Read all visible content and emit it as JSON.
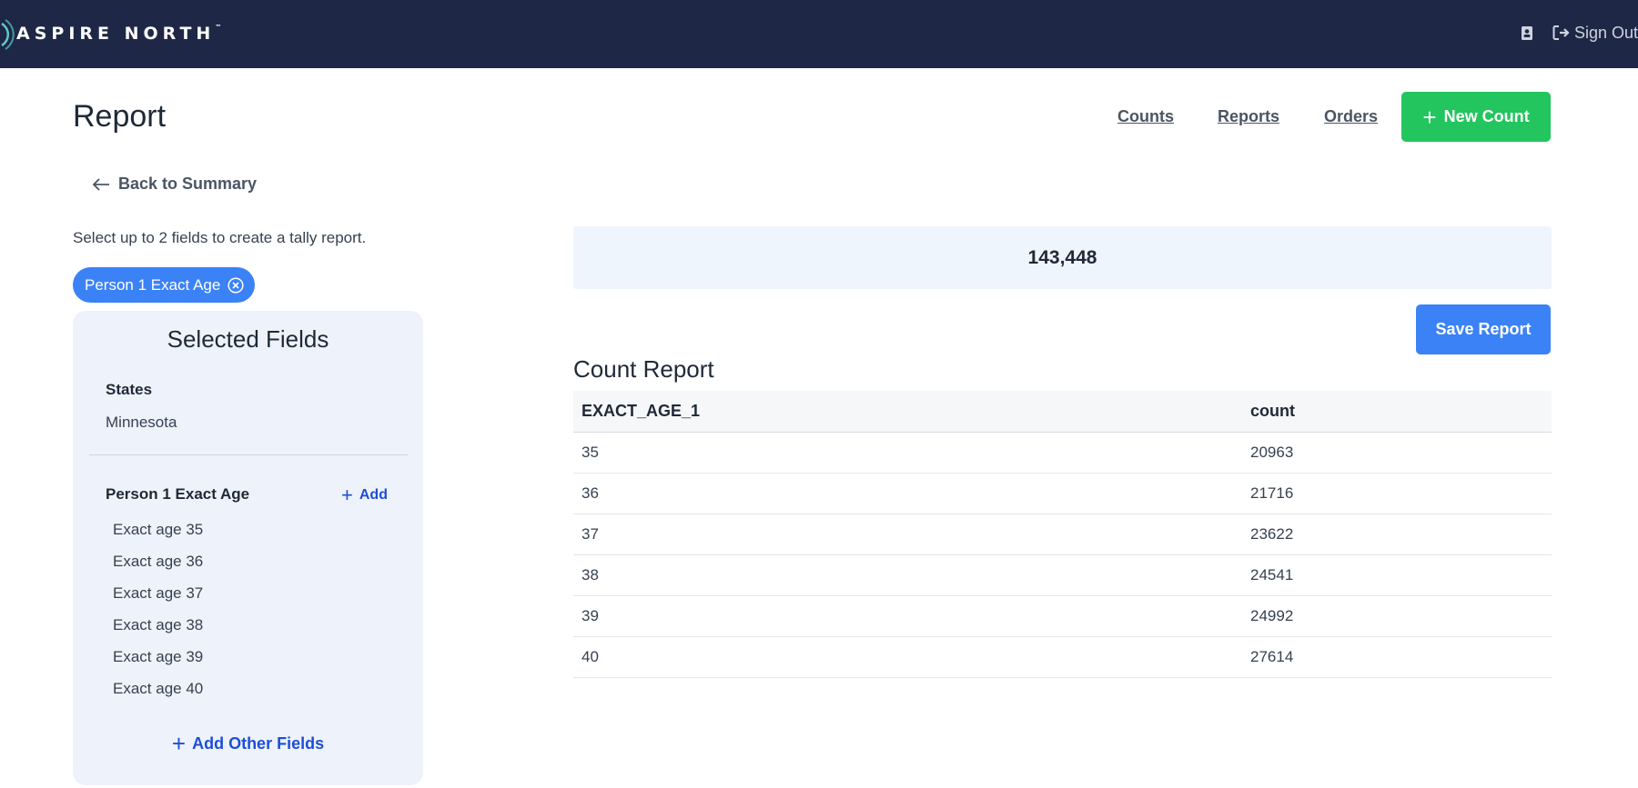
{
  "brand": {
    "name": "ASPIRE NORTH",
    "trademark": "™"
  },
  "topbar": {
    "sign_out_label": "Sign Out",
    "contact_icon": "address-book-icon",
    "sign_out_icon": "sign-out-icon"
  },
  "page": {
    "title": "Report"
  },
  "nav": {
    "items": [
      {
        "label": "Counts"
      },
      {
        "label": "Reports"
      },
      {
        "label": "Orders"
      }
    ],
    "new_count_label": "New Count"
  },
  "back": {
    "label": "Back to Summary"
  },
  "instruction": "Select up to 2 fields to create a tally report.",
  "chip": {
    "label": "Person 1 Exact Age"
  },
  "selected_fields": {
    "title": "Selected Fields",
    "groups": [
      {
        "label": "States",
        "values": [
          "Minnesota"
        ]
      },
      {
        "label": "Person 1 Exact Age",
        "add_label": "Add",
        "values": [
          "Exact age 35",
          "Exact age 36",
          "Exact age 37",
          "Exact age 38",
          "Exact age 39",
          "Exact age 40"
        ]
      }
    ],
    "add_other_label": "Add Other Fields"
  },
  "total": "143,448",
  "save_label": "Save Report",
  "report": {
    "title": "Count Report",
    "columns": [
      "EXACT_AGE_1",
      "count"
    ],
    "rows": [
      [
        "35",
        "20963"
      ],
      [
        "36",
        "21716"
      ],
      [
        "37",
        "23622"
      ],
      [
        "38",
        "24541"
      ],
      [
        "39",
        "24992"
      ],
      [
        "40",
        "27614"
      ]
    ]
  },
  "colors": {
    "topbar": "#1e2746",
    "primary": "#3b82f6",
    "success": "#22c55e",
    "panel": "#eef2fb"
  }
}
